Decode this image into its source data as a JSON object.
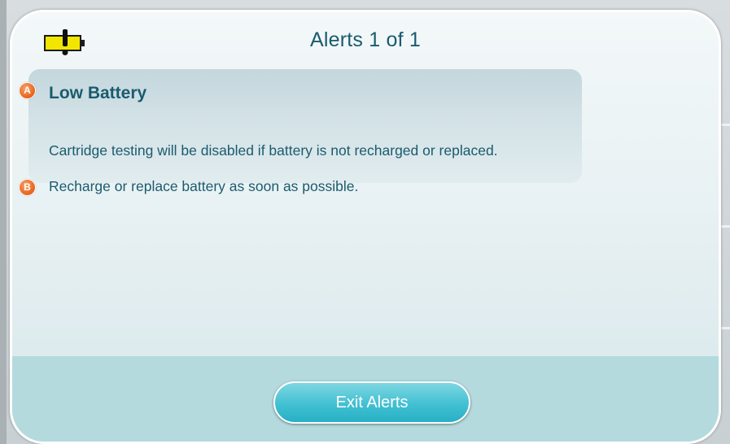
{
  "dialog": {
    "title": "Alerts  1 of 1",
    "icon": "battery-warning-icon"
  },
  "alert": {
    "heading": "Low Battery",
    "detail": "Cartridge testing will be disabled if battery is not recharged or replaced.",
    "action": "Recharge or replace battery as soon as possible."
  },
  "markers": {
    "a": "A",
    "b": "B"
  },
  "footer": {
    "exit_label": "Exit Alerts"
  },
  "colors": {
    "text": "#1a5b6e",
    "accent_button": "#41c0d2",
    "marker": "#ea6a24",
    "battery": "#f2e600",
    "footer": "#b4dade"
  }
}
